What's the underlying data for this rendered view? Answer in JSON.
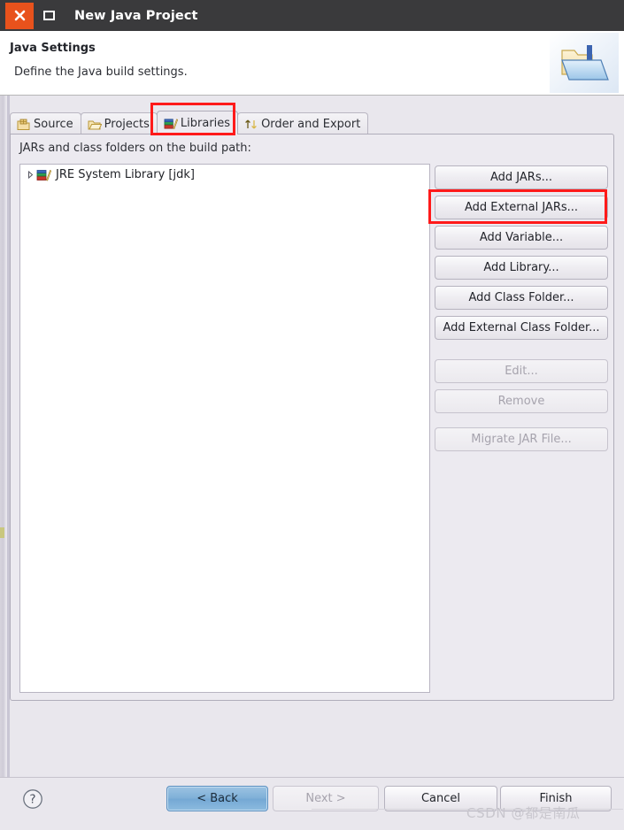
{
  "window": {
    "title": "New Java Project",
    "close_icon": "close-x-icon",
    "maximize_icon": "maximize-icon",
    "accent_orange": "#e8521c",
    "titlebar_color": "#3a3a3c"
  },
  "header": {
    "title": "Java Settings",
    "subtitle": "Define the Java build settings.",
    "banner_icon": "java-project-folder-icon"
  },
  "tabs": [
    {
      "label": "Source",
      "icon": "source-folder-icon",
      "active": false
    },
    {
      "label": "Projects",
      "icon": "open-folder-icon",
      "active": false
    },
    {
      "label": "Libraries",
      "icon": "libraries-books-icon",
      "active": true
    },
    {
      "label": "Order and Export",
      "icon": "order-arrows-icon",
      "active": false
    }
  ],
  "libraries_tab": {
    "list_label": "JARs and class folders on the build path:",
    "tree_items": [
      {
        "label": "JRE System Library [jdk]",
        "icon": "libraries-books-icon",
        "expandable": true,
        "expanded": false
      }
    ],
    "buttons": [
      {
        "label": "Add JARs...",
        "enabled": true
      },
      {
        "label": "Add External JARs...",
        "enabled": true
      },
      {
        "label": "Add Variable...",
        "enabled": true
      },
      {
        "label": "Add Library...",
        "enabled": true
      },
      {
        "label": "Add Class Folder...",
        "enabled": true
      },
      {
        "label": "Add External Class Folder...",
        "enabled": true
      },
      {
        "label": "Edit...",
        "enabled": false
      },
      {
        "label": "Remove",
        "enabled": false
      },
      {
        "label": "Migrate JAR File...",
        "enabled": false
      }
    ]
  },
  "annotations": {
    "color": "#ff1a1a",
    "boxes": [
      {
        "target": "Libraries tab"
      },
      {
        "target": "Add External JARs... button"
      }
    ]
  },
  "footer": {
    "help_icon": "help-question-icon",
    "back_label": "< Back",
    "next_label": "Next >",
    "cancel_label": "Cancel",
    "finish_label": "Finish",
    "back_enabled": true,
    "next_enabled": false
  },
  "watermark": {
    "text": "CSDN @都是南瓜"
  }
}
